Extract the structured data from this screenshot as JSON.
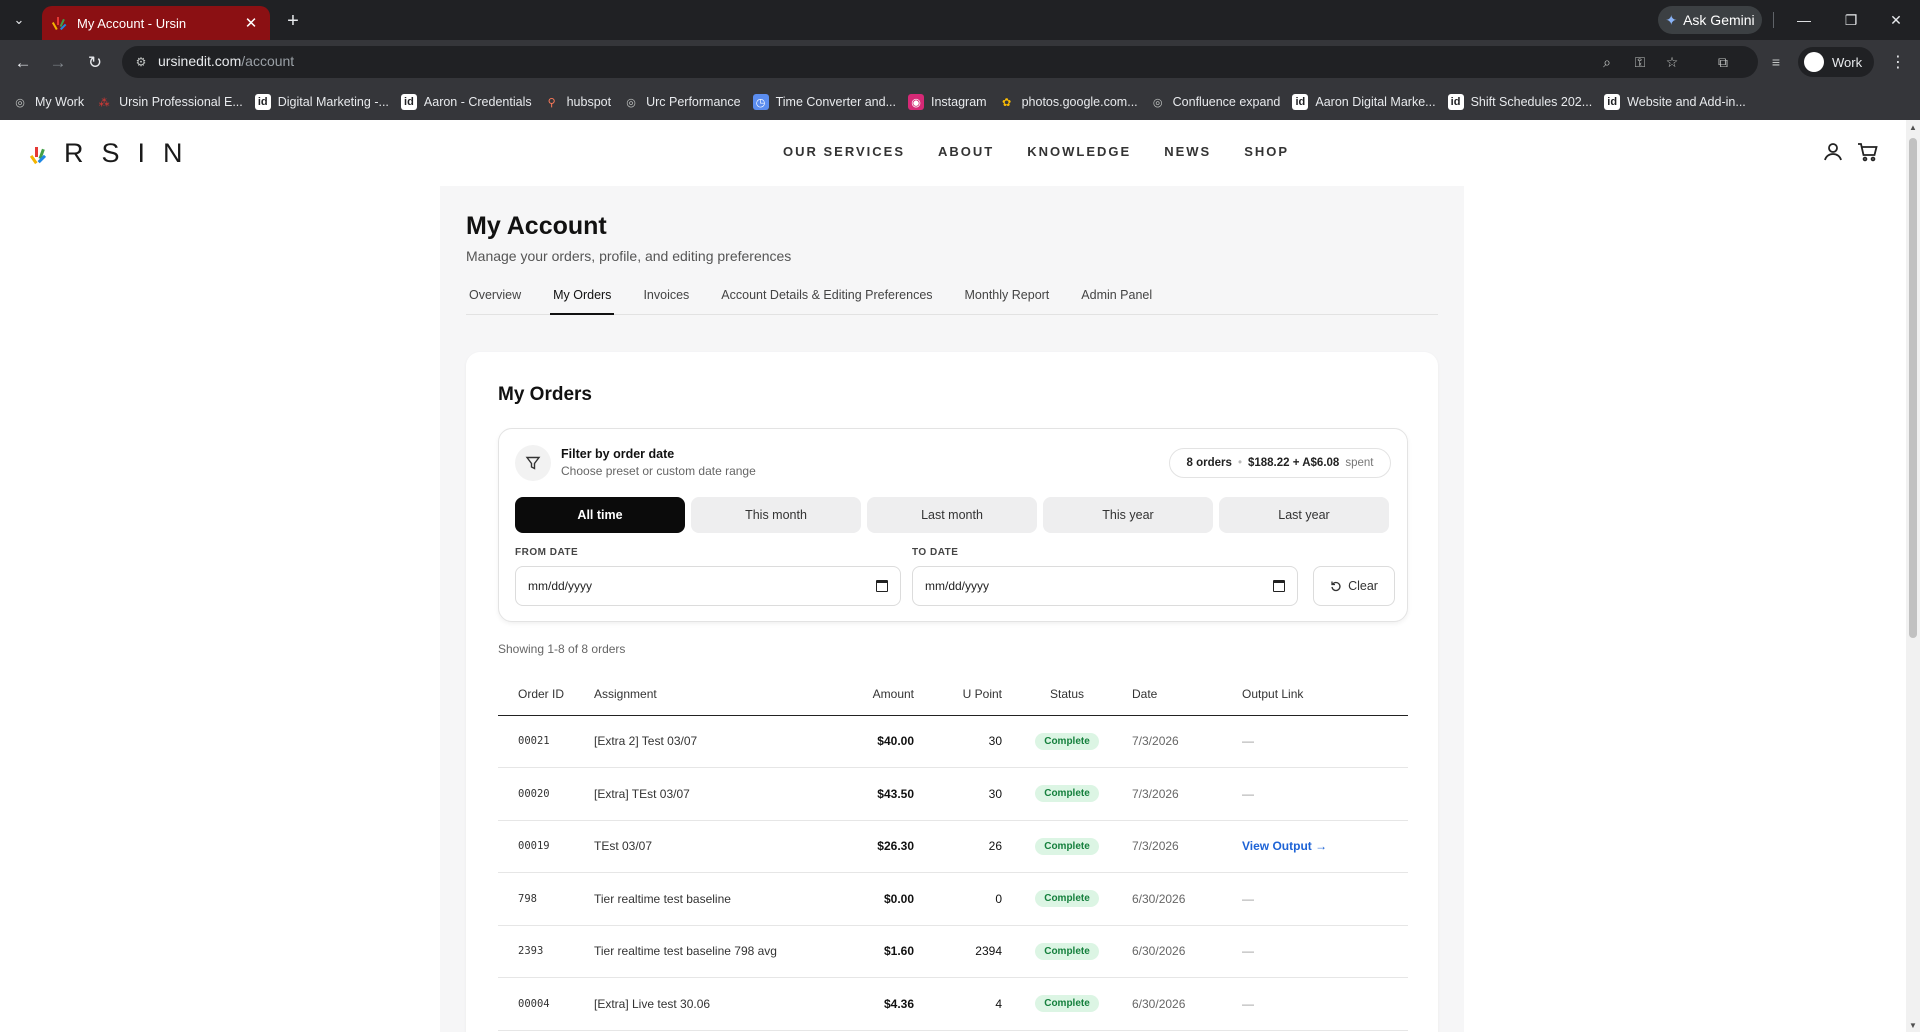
{
  "browser": {
    "tab_title": "My Account - Ursin",
    "new_tab": "+",
    "gemini_label": "Ask Gemini",
    "url_domain": "ursinedit.com",
    "url_path": "/account",
    "profile_label": "Work"
  },
  "bookmarks": [
    {
      "label": "My Work",
      "icon": "globe-icon"
    },
    {
      "label": "Ursin Professional E...",
      "icon": "ursin-icon"
    },
    {
      "label": "Digital Marketing -...",
      "icon": "doc-icon"
    },
    {
      "label": "Aaron - Credentials",
      "icon": "doc-icon"
    },
    {
      "label": "hubspot",
      "icon": "hubspot-icon"
    },
    {
      "label": "Urc Performance",
      "icon": "globe-icon"
    },
    {
      "label": "Time Converter and...",
      "icon": "clock-icon"
    },
    {
      "label": "Instagram",
      "icon": "instagram-icon"
    },
    {
      "label": "photos.google.com...",
      "icon": "photos-icon"
    },
    {
      "label": "Confluence expand",
      "icon": "globe-icon"
    },
    {
      "label": "Aaron Digital Marke...",
      "icon": "doc-icon"
    },
    {
      "label": "Shift Schedules 202...",
      "icon": "doc-icon"
    },
    {
      "label": "Website and Add-in...",
      "icon": "doc-icon"
    }
  ],
  "site": {
    "logo_text": "RSIN",
    "nav": [
      "OUR SERVICES",
      "ABOUT",
      "KNOWLEDGE",
      "NEWS",
      "SHOP"
    ]
  },
  "account": {
    "title": "My Account",
    "subtitle": "Manage your orders, profile, and editing preferences",
    "tabs": [
      "Overview",
      "My Orders",
      "Invoices",
      "Account Details & Editing Preferences",
      "Monthly Report",
      "Admin Panel"
    ],
    "active_tab": "My Orders"
  },
  "orders": {
    "title": "My Orders",
    "filter": {
      "label": "Filter by order date",
      "sub": "Choose preset or custom date range",
      "summary_count": "8 orders",
      "summary_dot": "•",
      "summary_amount": "$188.22 + A$6.08",
      "summary_suffix": "spent",
      "presets": [
        "All time",
        "This month",
        "Last month",
        "This year",
        "Last year"
      ],
      "active_preset": "All time",
      "from_label": "FROM DATE",
      "to_label": "TO DATE",
      "from_value": "mm/dd/yyyy",
      "to_value": "mm/dd/yyyy",
      "clear_label": "Clear"
    },
    "showing": "Showing 1-8 of 8 orders",
    "columns": [
      "Order ID",
      "Assignment",
      "Amount",
      "U Point",
      "Status",
      "Date",
      "Output Link"
    ],
    "rows": [
      {
        "id": "00021",
        "assignment": "[Extra 2] Test 03/07",
        "amount": "$40.00",
        "upoint": "30",
        "status": "Complete",
        "date": "7/3/2026",
        "output": "—"
      },
      {
        "id": "00020",
        "assignment": "[Extra] TEst 03/07",
        "amount": "$43.50",
        "upoint": "30",
        "status": "Complete",
        "date": "7/3/2026",
        "output": "—"
      },
      {
        "id": "00019",
        "assignment": "TEst 03/07",
        "amount": "$26.30",
        "upoint": "26",
        "status": "Complete",
        "date": "7/3/2026",
        "output": "View Output →"
      },
      {
        "id": "798",
        "assignment": "Tier realtime test baseline",
        "amount": "$0.00",
        "upoint": "0",
        "status": "Complete",
        "date": "6/30/2026",
        "output": "—"
      },
      {
        "id": "2393",
        "assignment": "Tier realtime test baseline 798 avg",
        "amount": "$1.60",
        "upoint": "2394",
        "status": "Complete",
        "date": "6/30/2026",
        "output": "—"
      },
      {
        "id": "00004",
        "assignment": "[Extra] Live test 30.06",
        "amount": "$4.36",
        "upoint": "4",
        "status": "Complete",
        "date": "6/30/2026",
        "output": "—"
      }
    ]
  }
}
